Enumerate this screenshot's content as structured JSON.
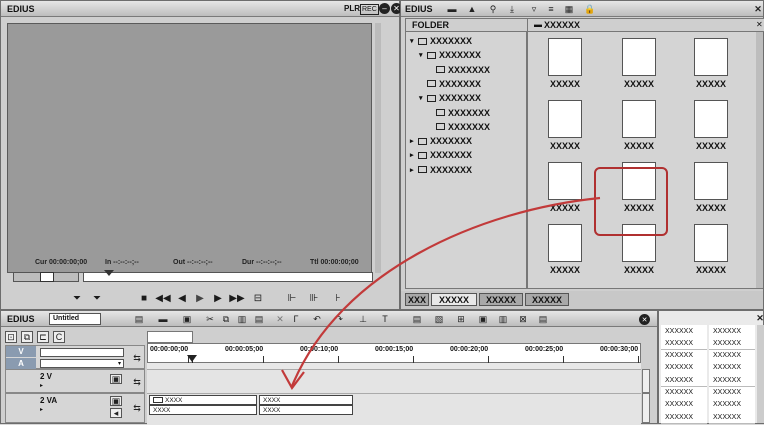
{
  "player": {
    "app_title": "EDIUS",
    "plr_label": "PLR",
    "rec_label": "REC",
    "status": {
      "cur": "Cur 00:00:00;00",
      "in": "In --:--:--;--",
      "out": "Out --:--:--;--",
      "dur": "Dur --:--:--;--",
      "ttl": "Ttl 00:00:00;00"
    }
  },
  "bin": {
    "app_title": "EDIUS",
    "folder_header": "FOLDER",
    "clip_header": "XXXXXX",
    "folders": [
      {
        "label": "XXXXXXX",
        "indent": 0,
        "expand": "▾"
      },
      {
        "label": "XXXXXXX",
        "indent": 1,
        "expand": "▾"
      },
      {
        "label": "XXXXXXX",
        "indent": 2,
        "expand": ""
      },
      {
        "label": "XXXXXXX",
        "indent": 1,
        "expand": ""
      },
      {
        "label": "XXXXXXX",
        "indent": 1,
        "expand": "▾"
      },
      {
        "label": "XXXXXXX",
        "indent": 2,
        "expand": ""
      },
      {
        "label": "XXXXXXX",
        "indent": 2,
        "expand": ""
      },
      {
        "label": "XXXXXXX",
        "indent": 0,
        "expand": "▸"
      },
      {
        "label": "XXXXXXX",
        "indent": 0,
        "expand": "▸"
      },
      {
        "label": "XXXXXXX",
        "indent": 0,
        "expand": "▸"
      }
    ],
    "clips": [
      "XXXXX",
      "XXXXX",
      "XXXXX",
      "XXXXX",
      "XXXXX",
      "XXXXX",
      "XXXXX",
      "XXXXX",
      "XXXXX",
      "XXXXX",
      "XXXXX",
      "XXXXX"
    ],
    "tabs": [
      "XXX",
      "XXXXX",
      "XXXXX",
      "XXXXX"
    ]
  },
  "timeline": {
    "app_title": "EDIUS",
    "sequence_name": "Untitled",
    "ruler": [
      "00:00:00;00",
      "00:00:05;00",
      "00:00:10;00",
      "00:00:15;00",
      "00:00:20;00",
      "00:00:25;00",
      "00:00:30;00"
    ],
    "tracks": [
      {
        "label": "V"
      },
      {
        "label": "A"
      },
      {
        "label": "2 V"
      },
      {
        "label": "2 VA"
      }
    ],
    "clips": [
      {
        "top": "XXXX",
        "bottom": "XXXX"
      },
      {
        "top": "XXXX",
        "bottom": "XXXX"
      }
    ]
  },
  "info_panel": {
    "rows": [
      [
        "XXXXXX",
        "XXXXXX"
      ],
      [
        "XXXXXX",
        "XXXXXX"
      ],
      [
        "XXXXXX",
        "XXXXXX"
      ],
      [
        "XXXXXX",
        "XXXXXX"
      ],
      [
        "XXXXXX",
        "XXXXXX"
      ],
      [
        "XXXXXX",
        "XXXXXX"
      ],
      [
        "XXXXXX",
        "XXXXXX"
      ],
      [
        "XXXXXX",
        "XXXXXX"
      ]
    ]
  },
  "colors": {
    "highlight": "#b03030",
    "arrow": "#c23a3a"
  }
}
